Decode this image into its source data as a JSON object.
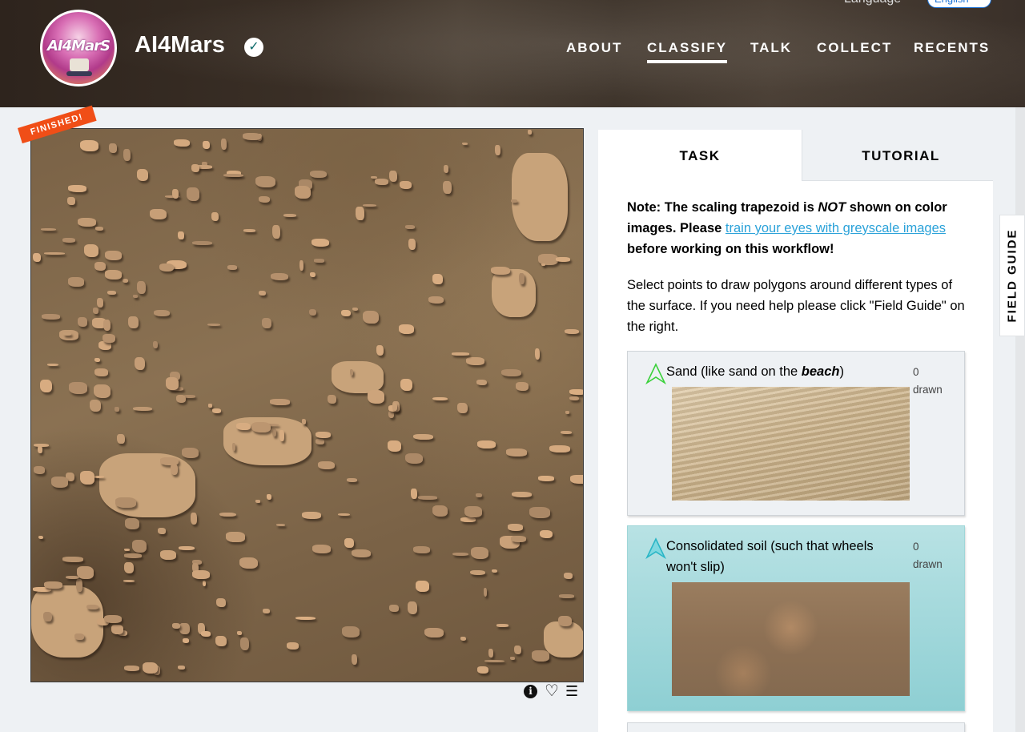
{
  "header": {
    "project_title": "AI4Mars",
    "logo_text": "AI4MarS",
    "language_label": "Language",
    "language_value": "English",
    "nav": [
      "ABOUT",
      "CLASSIFY",
      "TALK",
      "COLLECT",
      "RECENTS"
    ],
    "active_nav": "CLASSIFY"
  },
  "subject": {
    "status_ribbon": "FINISHED!"
  },
  "task_panel": {
    "tabs": [
      "TASK",
      "TUTORIAL"
    ],
    "active_tab": "TASK",
    "note_prefix": "Note: The scaling trapezoid is ",
    "note_emphasis": "NOT",
    "note_middle": " shown on color images. Please ",
    "note_link": "train your eyes with greyscale images",
    "note_suffix": " before working on this workflow!",
    "instruction": "Select points to draw polygons around different types of the surface. If you need help please click \"Field Guide\" on the right.",
    "answers": [
      {
        "label_prefix": "Sand (like sand on the ",
        "label_emphasis": "beach",
        "label_suffix": ")",
        "count": "0",
        "count_unit": "drawn",
        "tool_color": "#3bd13b"
      },
      {
        "label": "Consolidated soil (such that wheels won't slip)",
        "count": "0",
        "count_unit": "drawn",
        "tool_color": "#2ab6c6"
      }
    ]
  },
  "field_guide_label": "FIELD GUIDE",
  "colors": {
    "ribbon": "#f04e17",
    "link": "#2ba2d9",
    "soil_highlight": "#8ecfd3"
  }
}
